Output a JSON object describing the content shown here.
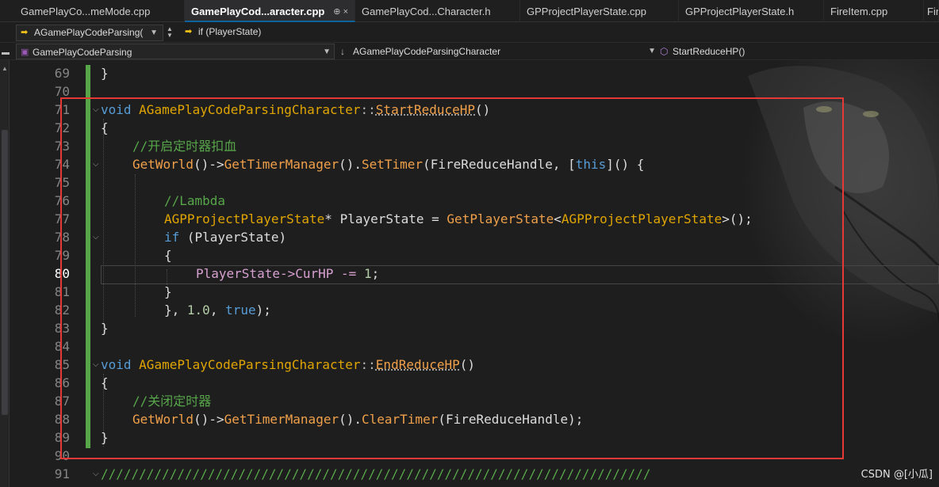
{
  "tabs": [
    {
      "label": "GamePlayCo...meMode.cpp",
      "active": false
    },
    {
      "label": "GamePlayCod...aracter.cpp",
      "active": true,
      "pin": "⊕ ×"
    },
    {
      "label": "GamePlayCod...Character.h",
      "active": false
    },
    {
      "label": "GPProjectPlayerState.cpp",
      "active": false
    },
    {
      "label": "GPProjectPlayerState.h",
      "active": false
    },
    {
      "label": "FireItem.cpp",
      "active": false
    },
    {
      "label": "Fir",
      "active": false
    }
  ],
  "nav": {
    "class_combo": "AGamePlayCodeParsing(",
    "scope_combo": "if (PlayerState)"
  },
  "scope": {
    "project": "GamePlayCodeParsing",
    "class": "AGamePlayCodeParsingCharacter",
    "member": "StartReduceHP()"
  },
  "editor": {
    "current_line": 80,
    "lines": [
      69,
      70,
      71,
      72,
      73,
      74,
      75,
      76,
      77,
      78,
      79,
      80,
      81,
      82,
      83,
      84,
      85,
      86,
      87,
      88,
      89,
      90,
      91
    ],
    "code": {
      "l69": "}",
      "l71_void": "void",
      "l71_class": "AGamePlayCodeParsingCharacter",
      "l71_sep": "::",
      "l71_fn": "StartReduceHP",
      "l71_paren": "()",
      "l72": "{",
      "l73": "//开启定时器扣血",
      "l74_getworld": "GetWorld",
      "l74_p1": "()->",
      "l74_gtm": "GetTimerManager",
      "l74_p2": "().",
      "l74_settimer": "SetTimer",
      "l74_args": "(FireReduceHandle, [",
      "l74_this": "this",
      "l74_end": "]() {",
      "l76": "//Lambda",
      "l77_type": "AGPProjectPlayerState",
      "l77_mid": "* PlayerState = ",
      "l77_fn": "GetPlayerState",
      "l77_lt": "<",
      "l77_tmpl": "AGPProjectPlayerState",
      "l77_end": ">();",
      "l78_if": "if",
      "l78_rest": " (PlayerState)",
      "l79": "{",
      "l80_a": "PlayerState->",
      "l80_b": "CurHP -= ",
      "l80_num": "1",
      "l80_end": ";",
      "l81": "}",
      "l82_a": "}, ",
      "l82_num": "1.0",
      "l82_b": ", ",
      "l82_true": "true",
      "l82_end": ");",
      "l83": "}",
      "l85_void": "void",
      "l85_class": "AGamePlayCodeParsingCharacter",
      "l85_sep": "::",
      "l85_fn": "EndReduceHP",
      "l85_paren": "()",
      "l86": "{",
      "l87": "//关闭定时器",
      "l88_getworld": "GetWorld",
      "l88_p1": "()->",
      "l88_gtm": "GetTimerManager",
      "l88_p2": "().",
      "l88_clear": "ClearTimer",
      "l88_args": "(FireReduceHandle);",
      "l89": "}",
      "l91": "////////////////////////////////////////////////////////////////////////"
    }
  },
  "watermark": "CSDN @[小瓜]",
  "colors": {
    "keyword": "#569cd6",
    "type": "#e0a500",
    "comment": "#57a64a",
    "annotation_box": "#e53935",
    "change_bar": "#57a64a"
  }
}
